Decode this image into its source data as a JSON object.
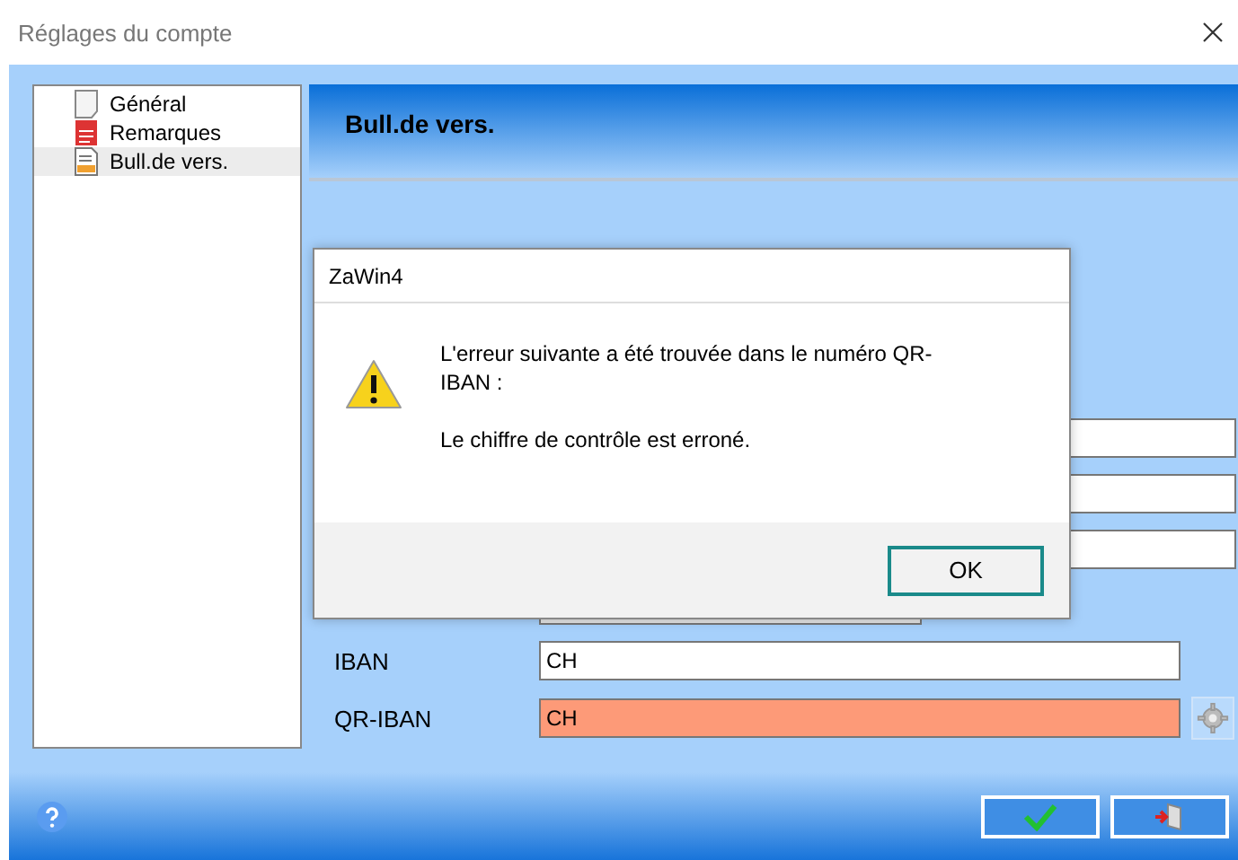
{
  "window": {
    "title": "Réglages du compte"
  },
  "sidebar": {
    "items": [
      {
        "label": "Général",
        "kind": "page",
        "selected": false
      },
      {
        "label": "Remarques",
        "kind": "notes",
        "selected": false
      },
      {
        "label": "Bull.de vers.",
        "kind": "slip",
        "selected": true
      }
    ]
  },
  "panel": {
    "title": "Bull.de vers.",
    "fields": [
      {
        "kind": "wide",
        "disabled": false
      },
      {
        "kind": "wide",
        "disabled": false
      },
      {
        "kind": "wide",
        "disabled": false
      },
      {
        "kind": "short",
        "disabled": true
      },
      {
        "kind": "normal",
        "label": "IBAN",
        "value": "CH",
        "error": false,
        "settings_button": false
      },
      {
        "kind": "normal",
        "label": "QR-IBAN",
        "value": "CH",
        "error": true,
        "settings_button": true
      }
    ]
  },
  "dialog": {
    "title": "ZaWin4",
    "message": "L'erreur suivante a été trouvée dans le numéro QR-IBAN :",
    "detail": "Le chiffre de contrôle est erroné.",
    "button": "OK"
  },
  "footer": {
    "buttons": [
      {
        "kind": "confirm"
      },
      {
        "kind": "exit"
      }
    ]
  }
}
